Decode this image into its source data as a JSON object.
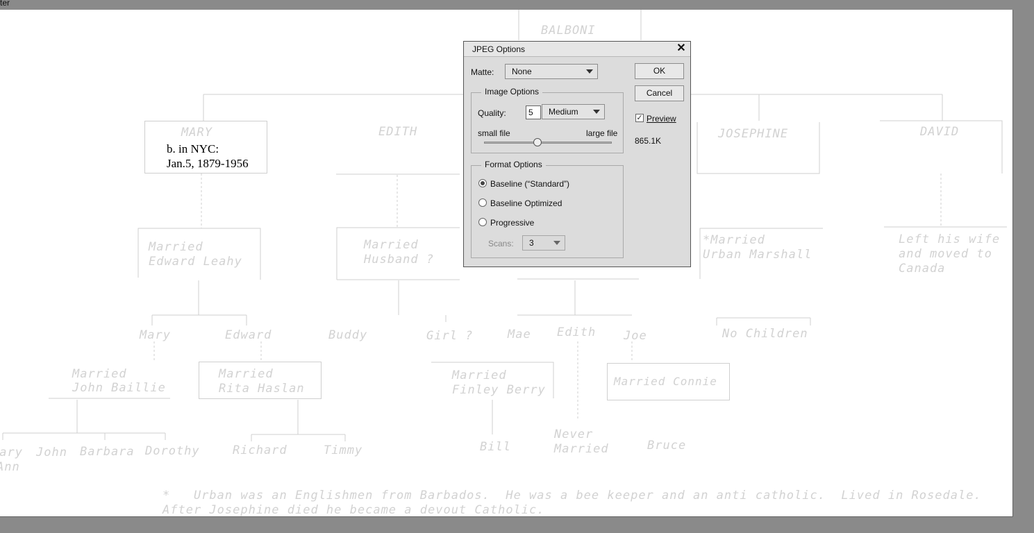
{
  "window": {
    "title_fragment": "ter"
  },
  "canvas": {
    "top_family": "BALBONI",
    "children": [
      "MARY",
      "EDITH",
      "JOSEPHINE",
      "DAVID"
    ],
    "mary_note_line1": "b. in NYC:",
    "mary_note_line2": "Jan.5, 1879-1956",
    "mary_spouse_1": "Married",
    "mary_spouse_2": "Edward Leahy",
    "edith_spouse_1": "Married",
    "edith_spouse_2": "Husband ?",
    "josephine_spouse_1": "*Married",
    "josephine_spouse_2": "Urban Marshall",
    "david_note_1": "Left his wife",
    "david_note_2": "and moved to",
    "david_note_3": "Canada",
    "gen2": {
      "mary": "Mary",
      "edward": "Edward",
      "buddy": "Buddy",
      "girl": "Girl ?",
      "mae": "Mae",
      "edith": "Edith",
      "joe": "Joe",
      "no_children": "No Children"
    },
    "mary_jr_spouse_1": "Married",
    "mary_jr_spouse_2": "John Baillie",
    "edward_spouse_1": "Married",
    "edward_spouse_2": "Rita Haslan",
    "mae_spouse_1": "Married",
    "mae_spouse_2": "Finley Berry",
    "joe_spouse": "Married Connie",
    "gen3": {
      "mary_ann_1": "Mary",
      "mary_ann_2": "Ann",
      "john": "John",
      "barbara": "Barbara",
      "dorothy": "Dorothy",
      "richard": "Richard",
      "timmy": "Timmy",
      "bill": "Bill",
      "never_1": "Never",
      "never_2": "Married",
      "bruce": "Bruce"
    },
    "footnote_1": "*   Urban was an Englishmen from Barbados.  He was a bee keeper and an anti catholic.  Lived in Rosedale.",
    "footnote_2": "After Josephine died he became a devout Catholic."
  },
  "dialog": {
    "title": "JPEG Options",
    "matte_label": "Matte:",
    "matte_value": "None",
    "ok_label": "OK",
    "cancel_label": "Cancel",
    "preview_label": "Preview",
    "preview_checked": true,
    "file_size": "865.1K",
    "image_options_title": "Image Options",
    "quality_label": "Quality:",
    "quality_value": "5",
    "quality_preset": "Medium",
    "small_file_label": "small file",
    "large_file_label": "large file",
    "quality_slider_fraction": 0.42,
    "format_options_title": "Format Options",
    "format_options": [
      {
        "label": "Baseline (“Standard”)",
        "selected": true
      },
      {
        "label": "Baseline Optimized",
        "selected": false
      },
      {
        "label": "Progressive",
        "selected": false
      }
    ],
    "scans_label": "Scans:",
    "scans_value": "3"
  }
}
